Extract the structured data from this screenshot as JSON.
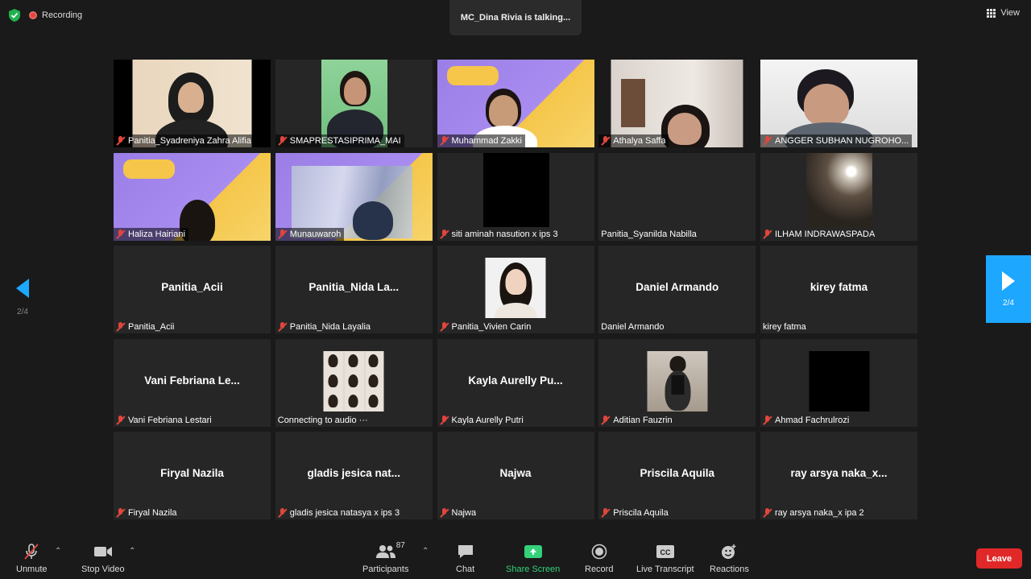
{
  "status": {
    "recording_label": "Recording",
    "talking_banner": "MC_Dina Rivia is talking...",
    "view_label": "View"
  },
  "nav": {
    "prev_page": "2/4",
    "next_page": "2/4"
  },
  "tiles": [
    {
      "label": "Panitia_Syadreniya Zahra Alifia",
      "center": "",
      "muted": true
    },
    {
      "label": "SMAPRESTASIPRIMA_MAI",
      "center": "",
      "muted": true
    },
    {
      "label": "Muhammad Zakki",
      "center": "",
      "muted": true
    },
    {
      "label": "Athalya Saffa",
      "center": "",
      "muted": true
    },
    {
      "label": "ANGGER SUBHAN NUGROHO...",
      "center": "",
      "muted": true
    },
    {
      "label": "Haliza Hairiani",
      "center": "",
      "muted": true
    },
    {
      "label": "Munauwaroh",
      "center": "",
      "muted": true
    },
    {
      "label": "siti aminah nasution x ips 3",
      "center": "",
      "muted": true
    },
    {
      "label": "Panitia_Syanilda Nabilla",
      "center": "",
      "muted": false
    },
    {
      "label": "ILHAM INDRAWASPADA",
      "center": "",
      "muted": true
    },
    {
      "label": "Panitia_Acii",
      "center": "Panitia_Acii",
      "muted": true
    },
    {
      "label": "Panitia_Nida Layalia",
      "center": "Panitia_Nida  La...",
      "muted": true
    },
    {
      "label": "Panitia_Vivien Carin",
      "center": "",
      "muted": true
    },
    {
      "label": "Daniel Armando",
      "center": "Daniel Armando",
      "muted": false
    },
    {
      "label": "kirey fatma",
      "center": "kirey fatma",
      "muted": false
    },
    {
      "label": "Vani Febriana Lestari",
      "center": "Vani  Febriana  Le...",
      "muted": true
    },
    {
      "label": "Connecting to audio ···",
      "center": "",
      "muted": false
    },
    {
      "label": "Kayla Aurelly Putri",
      "center": "Kayla  Aurelly  Pu...",
      "muted": true
    },
    {
      "label": "Aditian Fauzrin",
      "center": "",
      "muted": true
    },
    {
      "label": "Ahmad Fachrulrozi",
      "center": "",
      "muted": true
    },
    {
      "label": "Firyal Nazila",
      "center": "Firyal Nazila",
      "muted": true
    },
    {
      "label": "gladis jesica natasya x ips 3",
      "center": "gladis  jesica  nat...",
      "muted": true
    },
    {
      "label": "Najwa",
      "center": "Najwa",
      "muted": true
    },
    {
      "label": "Priscila Aquila",
      "center": "Priscila Aquila",
      "muted": true
    },
    {
      "label": "ray arsya naka_x ipa 2",
      "center": "ray  arsya  naka_x...",
      "muted": true
    }
  ],
  "toolbar": {
    "unmute": "Unmute",
    "stop_video": "Stop Video",
    "participants": "Participants",
    "participants_count": "87",
    "chat": "Chat",
    "share_screen": "Share Screen",
    "record": "Record",
    "live_transcript": "Live Transcript",
    "reactions": "Reactions",
    "leave": "Leave"
  },
  "colors": {
    "accent": "#1ea7ff",
    "share": "#33d17a",
    "leave": "#e02828",
    "muted": "#e0463c"
  }
}
